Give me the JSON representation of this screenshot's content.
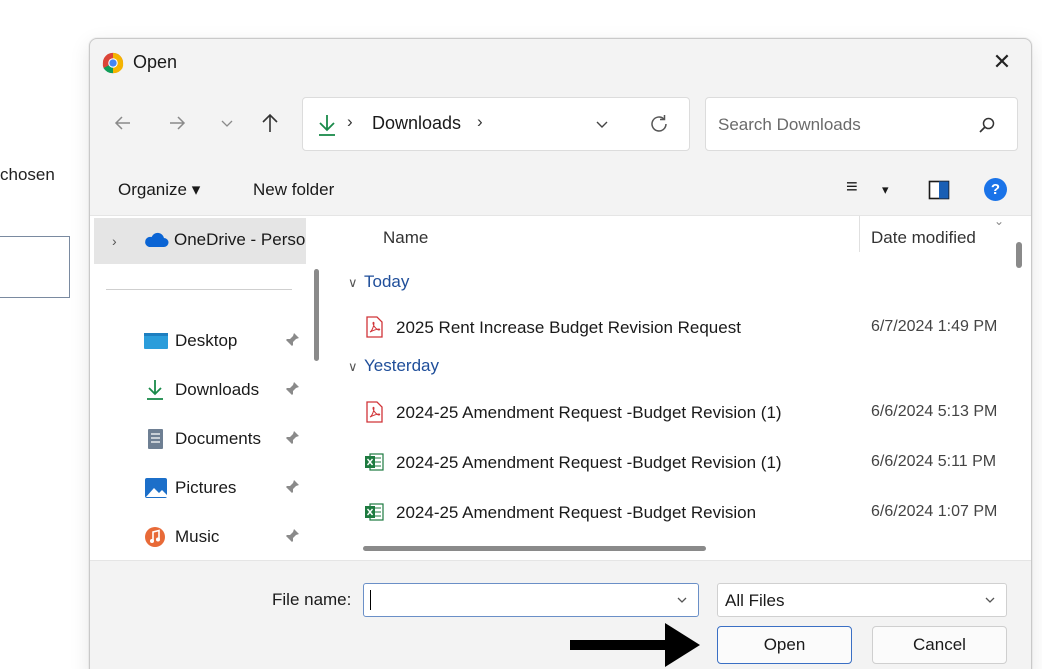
{
  "background": {
    "partial_text": "chosen"
  },
  "dialog": {
    "title": "Open",
    "close_glyph": "✕"
  },
  "nav": {
    "back": "←",
    "forward": "→",
    "recent": "⌄",
    "up": "↑"
  },
  "address": {
    "separator": "›",
    "crumb": "Downloads",
    "refresh": "⟳"
  },
  "search": {
    "placeholder": "Search Downloads"
  },
  "toolbar": {
    "organize": "Organize ▾",
    "new_folder": "New folder",
    "view_glyph": "≡",
    "view_dropdown": "▾",
    "help_glyph": "?"
  },
  "sidebar": {
    "onedrive": "OneDrive - Personal",
    "items": [
      {
        "label": "Desktop"
      },
      {
        "label": "Downloads"
      },
      {
        "label": "Documents"
      },
      {
        "label": "Pictures"
      },
      {
        "label": "Music"
      }
    ]
  },
  "file_list": {
    "columns": {
      "name": "Name",
      "date": "Date modified"
    },
    "groups": [
      {
        "label": "Today"
      },
      {
        "label": "Yesterday"
      }
    ],
    "files": [
      {
        "name": "2025 Rent Increase Budget Revision Request",
        "date": "6/7/2024 1:49 PM",
        "type": "pdf"
      },
      {
        "name": "2024-25 Amendment Request -Budget Revision (1)",
        "date": "6/6/2024 5:13 PM",
        "type": "pdf"
      },
      {
        "name": "2024-25 Amendment Request -Budget Revision (1)",
        "date": "6/6/2024 5:11 PM",
        "type": "xlsx"
      },
      {
        "name": "2024-25 Amendment Request -Budget Revision",
        "date": "6/6/2024 1:07 PM",
        "type": "xlsx"
      }
    ]
  },
  "bottom": {
    "file_name_label": "File name:",
    "file_name_value": "",
    "file_type": "All Files",
    "open_label": "Open",
    "cancel_label": "Cancel"
  },
  "colors": {
    "accent": "#3a6fc4",
    "group_text": "#1f4e9a",
    "pdf_red": "#d13438",
    "excel_green": "#1d7a3f"
  }
}
